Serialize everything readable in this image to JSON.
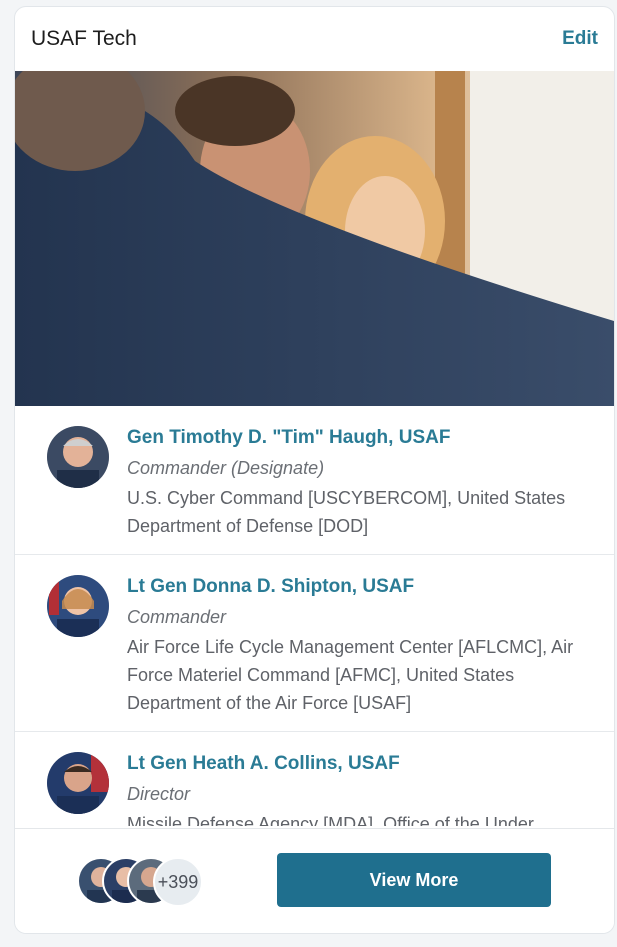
{
  "card": {
    "title": "USAF Tech",
    "edit_label": "Edit"
  },
  "people": [
    {
      "name": "Gen Timothy D. \"Tim\" Haugh, USAF",
      "role": "Commander (Designate)",
      "org": "U.S. Cyber Command [USCYBERCOM], United States Department of Defense [DOD]"
    },
    {
      "name": "Lt Gen Donna D. Shipton, USAF",
      "role": "Commander",
      "org": "Air Force Life Cycle Management Center [AFLCMC], Air Force Materiel Command [AFMC], United States Department of the Air Force [USAF]"
    },
    {
      "name": "Lt Gen Heath A. Collins, USAF",
      "role": "Director",
      "org": "Missile Defense Agency [MDA], Office of the Under"
    }
  ],
  "footer": {
    "more_count": "+399",
    "view_more_label": "View More"
  }
}
